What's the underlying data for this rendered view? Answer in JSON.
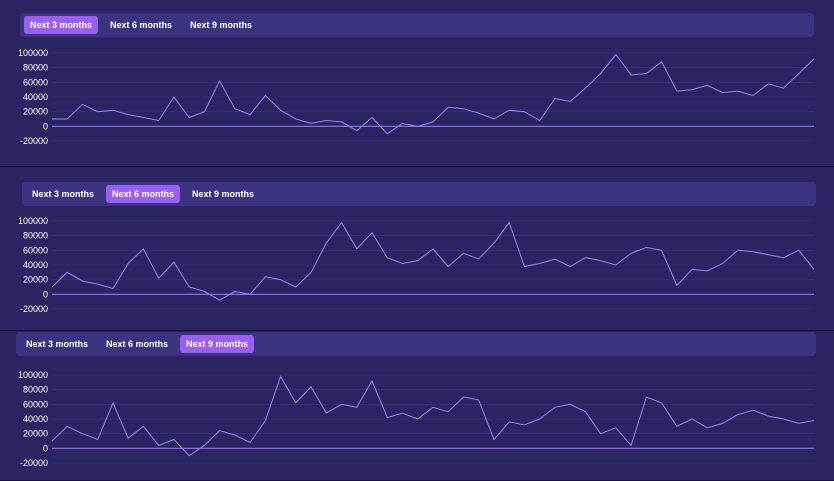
{
  "colors": {
    "page_bg": "#241f55",
    "panel_bg": "#2a2462",
    "tabbar_bg": "#3a3480",
    "active_tab": "#9a5ff2",
    "grid": "#3a3580",
    "zero_line": "#9b73f0",
    "series_line": "#9a86f5",
    "text": "#ffffff"
  },
  "panels": [
    {
      "tabs": [
        {
          "label": "Next 3 months",
          "active": true
        },
        {
          "label": "Next 6 months",
          "active": false
        },
        {
          "label": "Next 9 months",
          "active": false
        }
      ]
    },
    {
      "tabs": [
        {
          "label": "Next 3 months",
          "active": false
        },
        {
          "label": "Next 6 months",
          "active": true
        },
        {
          "label": "Next 9 months",
          "active": false
        }
      ]
    },
    {
      "tabs": [
        {
          "label": "Next 3 months",
          "active": false
        },
        {
          "label": "Next 6 months",
          "active": false
        },
        {
          "label": "Next 9 months",
          "active": true
        }
      ]
    }
  ],
  "chart_data": [
    {
      "type": "line",
      "title": "",
      "xlabel": "",
      "ylabel": "",
      "ylim": [
        -20000,
        100000
      ],
      "yticks": [
        100000,
        80000,
        60000,
        40000,
        20000,
        0,
        -20000
      ],
      "grid": true,
      "x": [
        0,
        2,
        4,
        6,
        8,
        10,
        12,
        14,
        16,
        18,
        20,
        22,
        24,
        26,
        28,
        30,
        32,
        34,
        36,
        38,
        40,
        42,
        44,
        46,
        48,
        50,
        52,
        54,
        56,
        58,
        60,
        62,
        64,
        66,
        68,
        70,
        72,
        74,
        76,
        78,
        80,
        82,
        84,
        86,
        88,
        90,
        92,
        94,
        96,
        98,
        100
      ],
      "series": [
        {
          "values": [
            10000,
            10000,
            30000,
            20000,
            22000,
            16000,
            12000,
            8000,
            40000,
            12000,
            20000,
            62000,
            24000,
            16000,
            42000,
            22000,
            10000,
            4000,
            8000,
            6000,
            -6000,
            12000,
            -10000,
            4000,
            0,
            6000,
            26000,
            24000,
            18000,
            10000,
            22000,
            20000,
            8000,
            38000,
            34000,
            52000,
            72000,
            98000,
            70000,
            72000,
            88000,
            48000,
            50000,
            56000,
            46000,
            48000,
            42000,
            58000,
            52000,
            72000,
            92000
          ]
        }
      ]
    },
    {
      "type": "line",
      "title": "",
      "xlabel": "",
      "ylabel": "",
      "ylim": [
        -20000,
        100000
      ],
      "yticks": [
        100000,
        80000,
        60000,
        40000,
        20000,
        0,
        -20000
      ],
      "grid": true,
      "x": [
        0,
        2,
        4,
        6,
        8,
        10,
        12,
        14,
        16,
        18,
        20,
        22,
        24,
        26,
        28,
        30,
        32,
        34,
        36,
        38,
        40,
        42,
        44,
        46,
        48,
        50,
        52,
        54,
        56,
        58,
        60,
        62,
        64,
        66,
        68,
        70,
        72,
        74,
        76,
        78,
        80,
        82,
        84,
        86,
        88,
        90,
        92,
        94,
        96,
        98,
        100
      ],
      "series": [
        {
          "values": [
            10000,
            30000,
            18000,
            14000,
            8000,
            42000,
            62000,
            22000,
            44000,
            10000,
            4000,
            -8000,
            4000,
            0,
            24000,
            20000,
            10000,
            30000,
            70000,
            98000,
            62000,
            84000,
            50000,
            42000,
            46000,
            62000,
            38000,
            56000,
            48000,
            70000,
            98000,
            38000,
            42000,
            48000,
            38000,
            50000,
            46000,
            40000,
            56000,
            64000,
            60000,
            12000,
            34000,
            32000,
            42000,
            60000,
            58000,
            54000,
            50000,
            60000,
            34000
          ]
        }
      ]
    },
    {
      "type": "line",
      "title": "",
      "xlabel": "",
      "ylabel": "",
      "ylim": [
        -20000,
        100000
      ],
      "yticks": [
        100000,
        80000,
        60000,
        40000,
        20000,
        0,
        -20000
      ],
      "grid": true,
      "x": [
        0,
        2,
        4,
        6,
        8,
        10,
        12,
        14,
        16,
        18,
        20,
        22,
        24,
        26,
        28,
        30,
        32,
        34,
        36,
        38,
        40,
        42,
        44,
        46,
        48,
        50,
        52,
        54,
        56,
        58,
        60,
        62,
        64,
        66,
        68,
        70,
        72,
        74,
        76,
        78,
        80,
        82,
        84,
        86,
        88,
        90,
        92,
        94,
        96,
        98,
        100
      ],
      "series": [
        {
          "values": [
            10000,
            30000,
            20000,
            12000,
            62000,
            14000,
            30000,
            4000,
            12000,
            -10000,
            4000,
            24000,
            18000,
            8000,
            38000,
            98000,
            62000,
            84000,
            48000,
            60000,
            56000,
            92000,
            42000,
            48000,
            40000,
            56000,
            50000,
            70000,
            66000,
            12000,
            36000,
            32000,
            40000,
            56000,
            60000,
            50000,
            20000,
            28000,
            4000,
            70000,
            62000,
            30000,
            40000,
            28000,
            34000,
            46000,
            52000,
            44000,
            40000,
            34000,
            38000
          ]
        }
      ]
    }
  ]
}
